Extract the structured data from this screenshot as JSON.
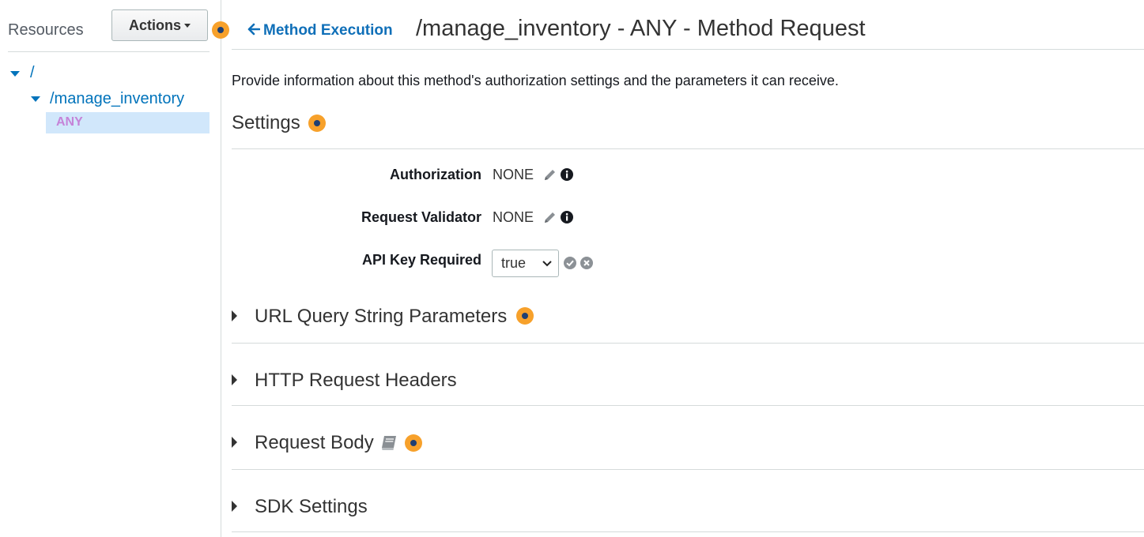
{
  "sidebar": {
    "title": "Resources",
    "actions_label": "Actions",
    "tree": {
      "root": "/",
      "resource": "/manage_inventory",
      "method": "ANY"
    }
  },
  "header": {
    "back_link": "Method Execution",
    "title": "/manage_inventory - ANY - Method Request"
  },
  "main": {
    "description": "Provide information about this method's authorization settings and the parameters it can receive.",
    "settings": {
      "title": "Settings",
      "rows": [
        {
          "label": "Authorization",
          "value": "NONE"
        },
        {
          "label": "Request Validator",
          "value": "NONE"
        },
        {
          "label": "API Key Required",
          "value": "true"
        }
      ]
    },
    "sections": [
      {
        "title": "URL Query String Parameters"
      },
      {
        "title": "HTTP Request Headers"
      },
      {
        "title": "Request Body"
      },
      {
        "title": "SDK Settings"
      }
    ]
  },
  "colors": {
    "link": "#0073bb",
    "help_dot": "#f7a12b",
    "selected_bg": "#d1e7fb",
    "method_text": "#c583d8"
  }
}
